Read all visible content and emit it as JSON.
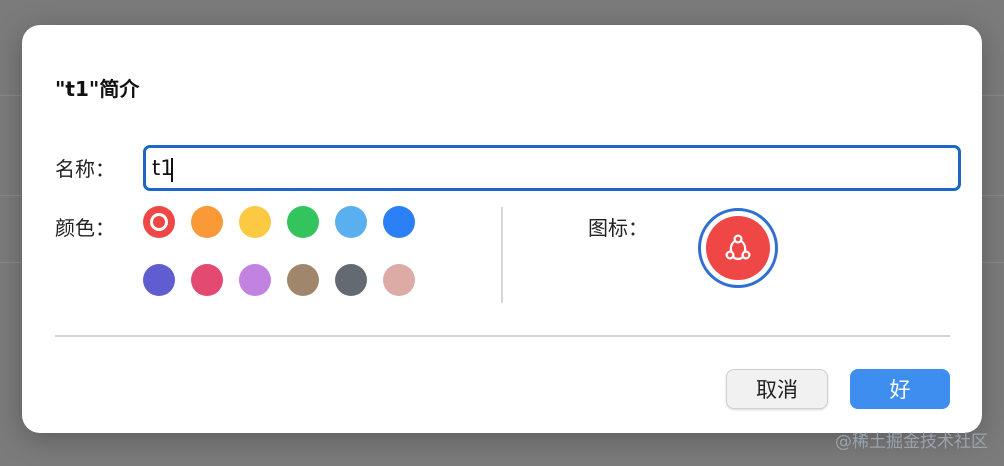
{
  "dialog": {
    "title": "\"t1\"简介",
    "name_label": "名称：",
    "name_value": "t1",
    "color_label": "颜色：",
    "icon_label": "图标：",
    "icon_name": "share-icon",
    "colors": [
      "#ef4745",
      "#f99a37",
      "#fbc942",
      "#33c45e",
      "#5ab0ef",
      "#2a80f4",
      "#5f5dd0",
      "#e24a72",
      "#c282df",
      "#a0876c",
      "#636a72",
      "#ddaba6"
    ],
    "selected_color": "#ef4745",
    "cancel_label": "取消",
    "ok_label": "好"
  },
  "watermark": "@稀土掘金技术社区"
}
